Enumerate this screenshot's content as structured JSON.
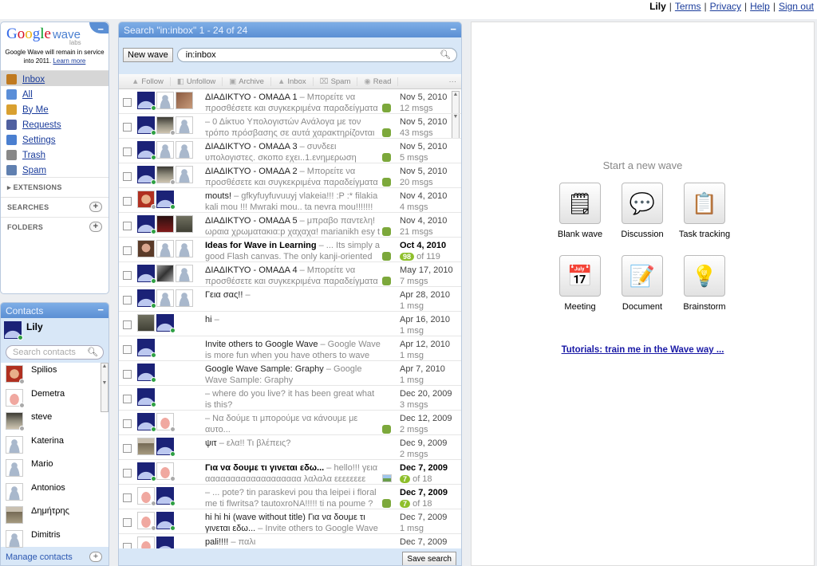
{
  "topbar": {
    "user": "Lily",
    "links": [
      "Terms",
      "Privacy",
      "Help",
      "Sign out"
    ]
  },
  "nav": {
    "logo": "Google wave",
    "logo_sub": "labs",
    "notice": "Google Wave will remain in service into 2011.",
    "learn_more": "Learn more",
    "items": [
      {
        "label": "Inbox",
        "icon": "inbox-icon",
        "color": "#c07a20",
        "selected": true
      },
      {
        "label": "All",
        "icon": "all-icon",
        "color": "#5a8ed8"
      },
      {
        "label": "By Me",
        "icon": "pencil-icon",
        "color": "#d9a030"
      },
      {
        "label": "Requests",
        "icon": "requests-icon",
        "color": "#5060a0"
      },
      {
        "label": "Settings",
        "icon": "wrench-icon",
        "color": "#4a7fd0"
      },
      {
        "label": "Trash",
        "icon": "trash-icon",
        "color": "#888"
      },
      {
        "label": "Spam",
        "icon": "spam-icon",
        "color": "#6080b0"
      }
    ],
    "sections": {
      "extensions": "EXTENSIONS",
      "searches": "SEARCHES",
      "folders": "FOLDERS"
    }
  },
  "contacts": {
    "title": "Contacts",
    "me": "Lily",
    "search_placeholder": "Search contacts",
    "manage": "Manage contacts",
    "list": [
      {
        "name": "Spilios",
        "avatar": "mustache",
        "status": "off"
      },
      {
        "name": "Demetra",
        "avatar": "patrick",
        "status": "off"
      },
      {
        "name": "steve",
        "avatar": "photo2",
        "status": "off"
      },
      {
        "name": "Katerina",
        "avatar": "default"
      },
      {
        "name": "Mario",
        "avatar": "default"
      },
      {
        "name": "Antonios",
        "avatar": "default"
      },
      {
        "name": "Δημήτρης",
        "avatar": "building"
      },
      {
        "name": "Dimitris",
        "avatar": "default"
      }
    ]
  },
  "search": {
    "title": "Search \"in:inbox\" 1 - 24 of 24",
    "new_wave": "New wave",
    "query": "in:inbox",
    "actions": [
      "Follow",
      "Unfollow",
      "Archive",
      "Inbox",
      "Spam",
      "Read"
    ],
    "save_search": "Save search",
    "rows": [
      {
        "subject": "ΔΙΑΔΙΚΤΥΟ - ΟΜΑΔΑ 1",
        "snippet": "Μπορείτε να προσθέσετε και συγκεκριμένα παραδείγματα",
        "date": "Nov 5, 2010",
        "count": "12 msgs",
        "ext": "puzzle",
        "avatars": [
          "space:on",
          "default",
          "photo1"
        ]
      },
      {
        "subject": "",
        "snippet": "0 Δίκτυο Υπολογιστών Ανάλογα με τον τρόπο πρόσβασης σε αυτά χαρακτηρίζονται ως",
        "date": "Nov 5, 2010",
        "count": "43 msgs",
        "ext": "puzzle",
        "avatars": [
          "space:on",
          "photo2:off",
          "default"
        ]
      },
      {
        "subject": "ΔΙΑΔΙΚΤΥΟ - ΟΜΑΔΑ 3",
        "snippet": "συνδεει υπολογιστες. σκοπο εχει..1.ενημερωση 2.ψυχαγωγια",
        "date": "Nov 5, 2010",
        "count": "5 msgs",
        "ext": "puzzle",
        "avatars": [
          "space:on",
          "default",
          "default"
        ]
      },
      {
        "subject": "ΔΙΑΔΙΚΤΥΟ - ΟΜΑΔΑ 2",
        "snippet": "Μπορείτε να προσθέσετε και συγκεκριμένα παραδείγματα",
        "date": "Nov 5, 2010",
        "count": "20 msgs",
        "ext": "puzzle",
        "avatars": [
          "space:on",
          "photo2:off",
          "default"
        ]
      },
      {
        "subject": "mouts!",
        "snippet": "gfkyfuyfuvuuyj vlakeia!!! :P :* filakia kali mou !!! Mwraki mou.. ta nevra mou!!!!!!!",
        "date": "Nov 4, 2010",
        "count": "4 msgs",
        "ext": "",
        "avatars": [
          "mustache:off",
          "space:on"
        ]
      },
      {
        "subject": "ΔΙΑΔΙΚΤΥΟ - ΟΜΑΔΑ 5",
        "snippet": "μπραβο παντελη! ωραια χρωματακια:p χαχαχα! marianikh esy t",
        "date": "Nov 4, 2010",
        "count": "21 msgs",
        "ext": "puzzle",
        "avatars": [
          "space:on",
          "photo3",
          "photo4"
        ]
      },
      {
        "subject": "Ideas for Wave in Learning",
        "snippet": "... Its simply a good Flash canvas. The only kanji-oriented part",
        "date": "Oct 4, 2010",
        "unread": "98",
        "count": "of 119",
        "ext": "puzzle",
        "bold": true,
        "avatars": [
          "face",
          "default",
          "default"
        ]
      },
      {
        "subject": "ΔΙΑΔΙΚΤΥΟ - ΟΜΑΔΑ 4",
        "snippet": "Μπορείτε να προσθέσετε και συγκεκριμένα παραδείγματα",
        "date": "May 17, 2010",
        "count": "7 msgs",
        "ext": "puzzle",
        "avatars": [
          "space:on",
          "bird",
          "default"
        ]
      },
      {
        "subject": "Γεια σας!!",
        "snippet": "",
        "date": "Apr 28, 2010",
        "count": "1 msg",
        "ext": "",
        "avatars": [
          "space:on",
          "default",
          "default"
        ]
      },
      {
        "subject": "hi",
        "snippet": "",
        "date": "Apr 16, 2010",
        "count": "1 msg",
        "ext": "",
        "avatars": [
          "photo4",
          "space:on"
        ]
      },
      {
        "subject": "Invite others to Google Wave",
        "snippet": "Google Wave is more fun when you have others to wave with, so",
        "date": "Apr 12, 2010",
        "count": "1 msg",
        "ext": "",
        "avatars": [
          "space:on"
        ]
      },
      {
        "subject": "Google Wave Sample: Graphy",
        "snippet": "Google Wave Sample: Graphy",
        "date": "Apr 7, 2010",
        "count": "1 msg",
        "ext": "",
        "avatars": [
          "space:on"
        ]
      },
      {
        "subject": "",
        "snippet": "where do you live? it has been great what is this?",
        "date": "Dec 20, 2009",
        "count": "3 msgs",
        "ext": "",
        "avatars": [
          "space:on"
        ]
      },
      {
        "subject": "",
        "snippet": "Να δούμε τι μπορούμε να κάνουμε με αυτο...",
        "date": "Dec 12, 2009",
        "count": "2 msgs",
        "ext": "puzzle",
        "avatars": [
          "space:on",
          "patrick:off"
        ]
      },
      {
        "subject": "ψιτ",
        "snippet": "ελα!! Τι βλέπεις?",
        "date": "Dec 9, 2009",
        "count": "2 msgs",
        "ext": "",
        "avatars": [
          "building",
          "space:on"
        ]
      },
      {
        "subject": "Για να δουμε τι γινεται εδω...",
        "snippet": "hello!!! γεια ααααααααααααααααααα λαλαλα εεεεεεεε",
        "date": "Dec 7, 2009",
        "unread": "7",
        "count": "of 18",
        "ext": "image",
        "bold": true,
        "avatars": [
          "space:on",
          "patrick:off"
        ]
      },
      {
        "subject": "",
        "snippet": "... pote? tin paraskevi pou tha leipei i floral me ti flwritsa? tautoxroNA!!!!! ti na poume ? xanθia",
        "date": "Dec 7, 2009",
        "unread": "7",
        "count": "of 18",
        "ext": "puzzle",
        "bold": true,
        "avatars": [
          "patrick:off",
          "space:on"
        ]
      },
      {
        "subject": "hi hi hi (wave without title) Για να δουμε τι γινεται εδω...",
        "snippet": "Invite others to Google Wave (wave",
        "date": "Dec 7, 2009",
        "count": "1 msg",
        "ext": "",
        "avatars": [
          "patrick:off",
          "space:on"
        ]
      },
      {
        "subject": "pali!!!!",
        "snippet": "παλι",
        "date": "Dec 7, 2009",
        "count": "",
        "ext": "",
        "avatars": [
          "patrick:off",
          "space:on"
        ]
      }
    ]
  },
  "newwave": {
    "title": "Start a new wave",
    "templates": [
      {
        "label": "Blank wave",
        "icon": "blank-wave-icon",
        "glyph": "🗒"
      },
      {
        "label": "Discussion",
        "icon": "discussion-icon",
        "glyph": "💬"
      },
      {
        "label": "Task tracking",
        "icon": "task-tracking-icon",
        "glyph": "📋"
      },
      {
        "label": "Meeting",
        "icon": "meeting-calendar-icon",
        "glyph": "📅"
      },
      {
        "label": "Document",
        "icon": "document-icon",
        "glyph": "📝"
      },
      {
        "label": "Brainstorm",
        "icon": "lightbulb-icon",
        "glyph": "💡"
      }
    ],
    "tutorial": "Tutorials: train me in the Wave way ..."
  }
}
